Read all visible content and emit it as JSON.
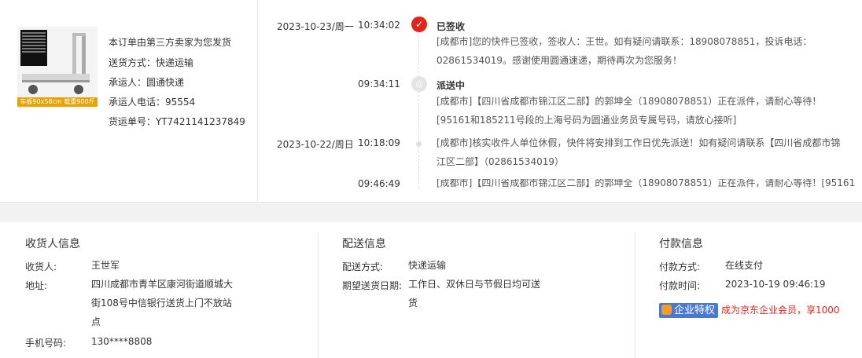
{
  "product": {
    "image_caption": "车板90x58cm 载重900斤",
    "seller_note": "本订单由第三方卖家为您发货",
    "shipping_method": "送货方式：快递运输",
    "carrier": "承运人：圆通快递",
    "carrier_phone": "承运人电话：95554",
    "tracking_number": "货运单号：YT7421141237849"
  },
  "timeline": [
    {
      "date": "2023-10-23/周一",
      "time": "10:34:02",
      "status": "已签收",
      "icon": "check-icon",
      "desc": "[成都市]您的快件已签收，签收人：王世。如有疑问请联系：18908078851，投诉电话：02861534019。感谢使用圆通速递，期待再次为您服务！"
    },
    {
      "date": "",
      "time": "09:34:11",
      "status": "派送中",
      "icon": "delivery-icon",
      "desc": "[成都市]【四川省成都市锦江区二部】的郭坤全（18908078851）正在派件，请耐心等待！[95161和185211号段的上海号码为圆通业务员专属号码，请放心接听]"
    },
    {
      "date": "2023-10-22/周日",
      "time": "10:18:09",
      "status": "",
      "icon": "dot",
      "desc": "[成都市]核实收件人单位休假，快件将安排到工作日优先派送！如有疑问请联系【四川省成都市锦江区二部】（02861534019）"
    },
    {
      "date": "",
      "time": "09:46:49",
      "status": "",
      "icon": "dot",
      "desc": "[成都市]【四川省成都市锦江区二部】的郭坤全（18908078851）正在派件，请耐心等待！[95161"
    }
  ],
  "receiver": {
    "title": "收货人信息",
    "name_key": "收货人:",
    "name_val": "王世军",
    "addr_key": "地址:",
    "addr_val": "四川成都市青羊区康河街道顺城大街108号中信银行送货上门不放站点",
    "phone_key": "手机号码:",
    "phone_val": "130****8808"
  },
  "delivery": {
    "title": "配送信息",
    "method_key": "配送方式:",
    "method_val": "快递运输",
    "date_key": "期望送货日期:",
    "date_val": "工作日、双休日与节假日均可送货"
  },
  "payment": {
    "title": "付款信息",
    "method_key": "付款方式:",
    "method_val": "在线支付",
    "time_key": "付款时间:",
    "time_val": "2023-10-19 09:46:19",
    "promo_badge": "企业特权",
    "promo_text": "成为京东企业会员，享1000"
  },
  "colors": {
    "accent": "#e1251b",
    "badge": "#4a79cf"
  }
}
